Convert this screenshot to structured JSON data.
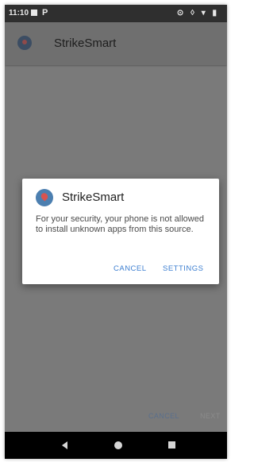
{
  "status_bar": {
    "time": "11:10",
    "icons_left": [
      "image-icon",
      "p-icon"
    ],
    "p_glyph": "P",
    "icons_right_glyph": "⊙ ◊ ▾ ▮"
  },
  "app_bar": {
    "title": "StrikeSmart",
    "icon": "app-logo-icon"
  },
  "dialog": {
    "title": "StrikeSmart",
    "message": "For your security, your phone is not allowed to install unknown apps from this source.",
    "cancel_label": "CANCEL",
    "settings_label": "SETTINGS",
    "accent_color": "#3d7fd1"
  },
  "background_buttons": {
    "cancel_label": "CANCEL",
    "next_label": "NEXT"
  },
  "nav_bar": {
    "buttons": [
      "back",
      "home",
      "recents"
    ]
  }
}
